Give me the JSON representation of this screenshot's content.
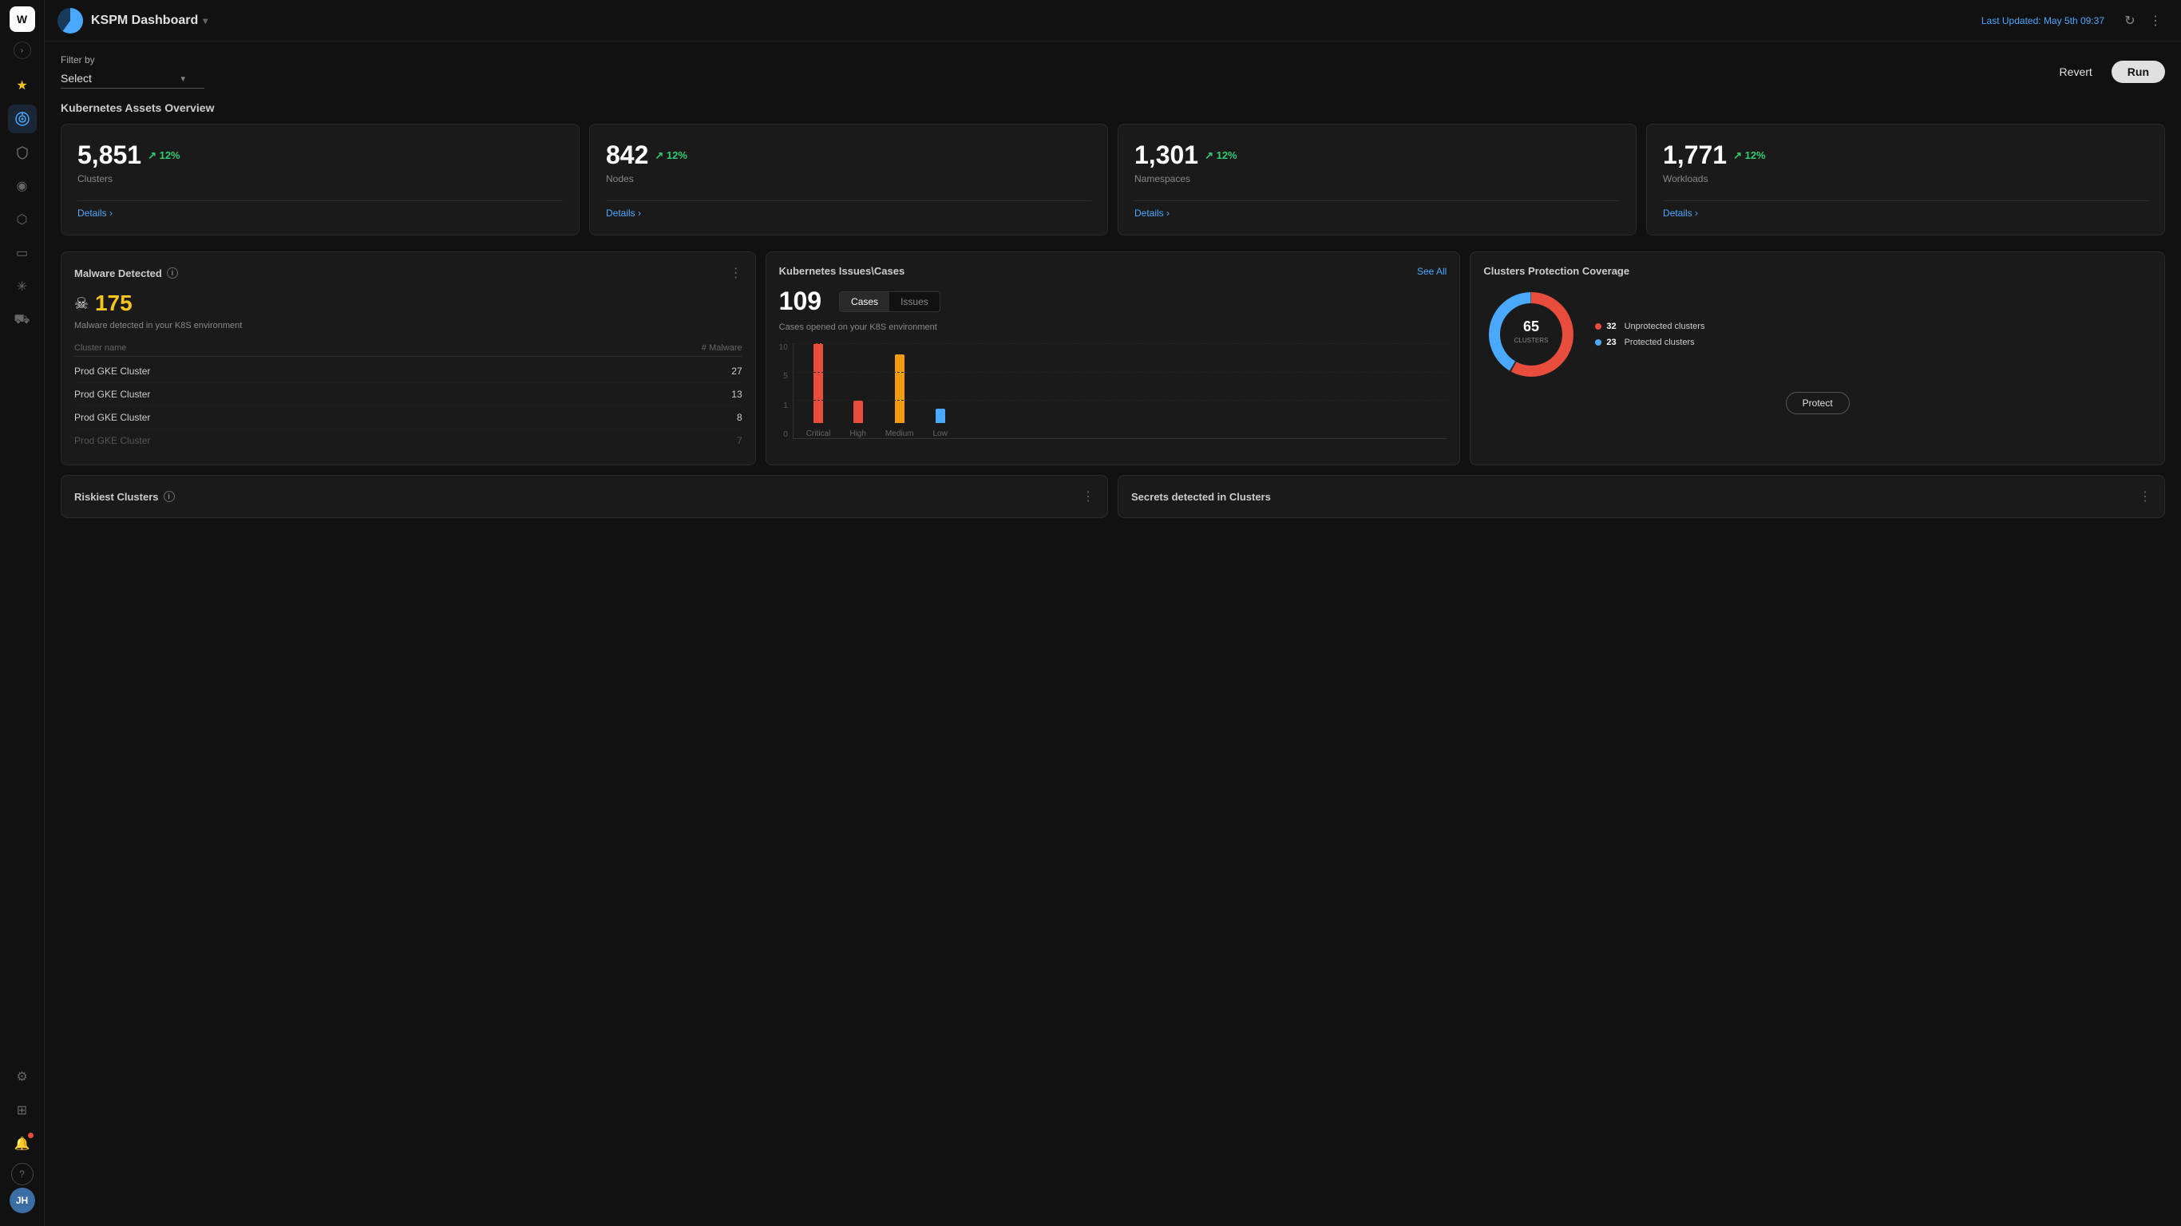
{
  "sidebar": {
    "logo_text": "W",
    "chevron_label": "›",
    "avatar_initials": "JH",
    "icons": [
      {
        "name": "star-icon",
        "symbol": "★",
        "class": "yellow"
      },
      {
        "name": "radar-icon",
        "symbol": "◎",
        "class": "active"
      },
      {
        "name": "shield-icon",
        "symbol": "⛨",
        "class": ""
      },
      {
        "name": "eye-icon",
        "symbol": "◉",
        "class": ""
      },
      {
        "name": "puzzle-icon",
        "symbol": "⬡",
        "class": ""
      },
      {
        "name": "terminal-icon",
        "symbol": "▭",
        "class": ""
      },
      {
        "name": "asterisk-icon",
        "symbol": "✳",
        "class": ""
      },
      {
        "name": "cart-icon",
        "symbol": "⛟",
        "class": ""
      },
      {
        "name": "gear-icon",
        "symbol": "⚙",
        "class": ""
      },
      {
        "name": "grid-icon",
        "symbol": "⊞",
        "class": ""
      },
      {
        "name": "bell-icon",
        "symbol": "🔔",
        "class": "red-dot"
      },
      {
        "name": "help-icon",
        "symbol": "?",
        "class": ""
      }
    ]
  },
  "topbar": {
    "logo_alt": "KSPM",
    "title": "KSPM Dashboard",
    "chevron": "▾",
    "last_updated_label": "Last Updated:",
    "last_updated_value": "May 5th 09:37",
    "refresh_icon": "↻",
    "more_icon": "⋮"
  },
  "filter": {
    "label": "Filter by",
    "select_placeholder": "Select",
    "chevron": "▾",
    "revert_label": "Revert",
    "run_label": "Run"
  },
  "assets": {
    "section_title": "Kubernetes Assets Overview",
    "cards": [
      {
        "value": "5,851",
        "pct": "↗ 12%",
        "label": "Clusters",
        "details": "Details ›"
      },
      {
        "value": "842",
        "pct": "↗ 12%",
        "label": "Nodes",
        "details": "Details ›"
      },
      {
        "value": "1,301",
        "pct": "↗ 12%",
        "label": "Namespaces",
        "details": "Details ›"
      },
      {
        "value": "1,771",
        "pct": "↗ 12%",
        "label": "Workloads",
        "details": "Details ›"
      }
    ]
  },
  "malware": {
    "title": "Malware Detected",
    "count": "175",
    "subtitle": "Malware detected in your K8S environment",
    "col_cluster": "Cluster name",
    "col_malware": "# Malware",
    "rows": [
      {
        "cluster": "Prod GKE Cluster",
        "count": "27"
      },
      {
        "cluster": "Prod GKE Cluster",
        "count": "13"
      },
      {
        "cluster": "Prod GKE Cluster",
        "count": "8"
      },
      {
        "cluster": "Prod GKE Cluster",
        "count": "7"
      }
    ]
  },
  "k8s_issues": {
    "title": "Kubernetes Issues\\Cases",
    "count": "109",
    "tabs": [
      "Cases",
      "Issues"
    ],
    "active_tab": "Cases",
    "subtitle": "Cases opened on your K8S environment",
    "see_all": "See All",
    "chart": {
      "y_labels": [
        "10",
        "5",
        "1",
        "0"
      ],
      "bars": [
        {
          "label": "Critical",
          "color": "#e74c3c",
          "height_pct": 85
        },
        {
          "label": "High",
          "color": "#e74c3c",
          "height_pct": 25
        },
        {
          "label": "Medium",
          "color": "#f39c12",
          "height_pct": 72
        },
        {
          "label": "Low",
          "color": "#4aa8ff",
          "height_pct": 15
        }
      ]
    }
  },
  "clusters_protection": {
    "title": "Clusters Protection Coverage",
    "total_clusters": "65",
    "total_label": "CLUSTERS",
    "unprotected_count": "32",
    "unprotected_label": "Unprotected clusters",
    "unprotected_color": "#e74c3c",
    "protected_count": "23",
    "protected_label": "Protected clusters",
    "protected_color": "#4aa8ff",
    "protect_btn": "Protect"
  },
  "riskiest": {
    "title": "Riskiest Clusters"
  },
  "secrets": {
    "title": "Secrets detected in Clusters"
  }
}
